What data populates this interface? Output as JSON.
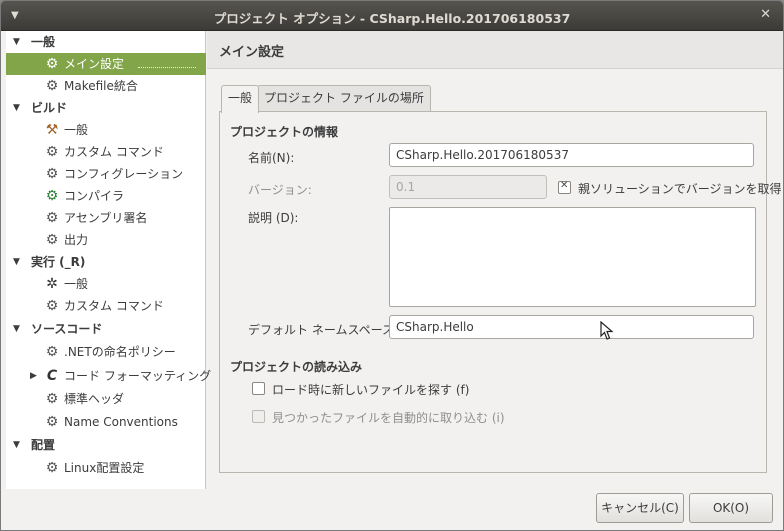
{
  "window": {
    "title": "プロジェクト オプション - CSharp.Hello.201706180537"
  },
  "sidebar": {
    "categories": [
      {
        "label": "一般",
        "items": [
          {
            "label": "メイン設定",
            "icon": "gear-icon",
            "selected": true
          },
          {
            "label": "Makefile統合",
            "icon": "gear-icon"
          }
        ]
      },
      {
        "label": "ビルド",
        "items": [
          {
            "label": "一般",
            "icon": "build-icon"
          },
          {
            "label": "カスタム コマンド",
            "icon": "gear-icon"
          },
          {
            "label": "コンフィグレーション",
            "icon": "gear-icon"
          },
          {
            "label": "コンパイラ",
            "icon": "compiler-icon"
          },
          {
            "label": "アセンブリ署名",
            "icon": "gear-icon"
          },
          {
            "label": "出力",
            "icon": "gear-icon"
          }
        ]
      },
      {
        "label": "実行 (_R)",
        "items": [
          {
            "label": "一般",
            "icon": "cog-icon"
          },
          {
            "label": "カスタム コマンド",
            "icon": "gear-icon"
          }
        ]
      },
      {
        "label": "ソースコード",
        "items": [
          {
            "label": ".NETの命名ポリシー",
            "icon": "gear-icon"
          },
          {
            "label": "コード フォーマッティング",
            "icon": "code-format-icon"
          },
          {
            "label": "標準ヘッダ",
            "icon": "gear-icon"
          },
          {
            "label": "Name Conventions",
            "icon": "gear-icon"
          }
        ]
      },
      {
        "label": "配置",
        "items": [
          {
            "label": "Linux配置設定",
            "icon": "gear-icon"
          }
        ]
      }
    ]
  },
  "main": {
    "header": "メイン設定",
    "tabs": [
      {
        "label": "一般",
        "active": true
      },
      {
        "label": "プロジェクト ファイルの場所",
        "active": false
      }
    ],
    "project_info": {
      "section_title": "プロジェクトの情報",
      "name_label": "名前(N):",
      "name_value": "CSharp.Hello.201706180537",
      "version_label": "バージョン:",
      "version_value": "0.1",
      "version_from_solution_label": "親ソリューションでバージョンを取得",
      "version_from_solution_checked": true,
      "description_label": "説明 (D):",
      "description_value": "",
      "namespace_label": "デフォルト ネームスペース:",
      "namespace_value": "CSharp.Hello"
    },
    "project_load": {
      "section_title": "プロジェクトの読み込み",
      "load_new_files_label": "ロード時に新しいファイルを探す (f)",
      "load_new_files_checked": false,
      "auto_import_label": "見つかったファイルを自動的に取り込む (i)",
      "auto_import_checked": false
    }
  },
  "buttons": {
    "cancel": "キャンセル(C)",
    "ok": "OK(O)"
  },
  "colors": {
    "selection": "#82a54a",
    "titlebar": "#3c3b37"
  }
}
